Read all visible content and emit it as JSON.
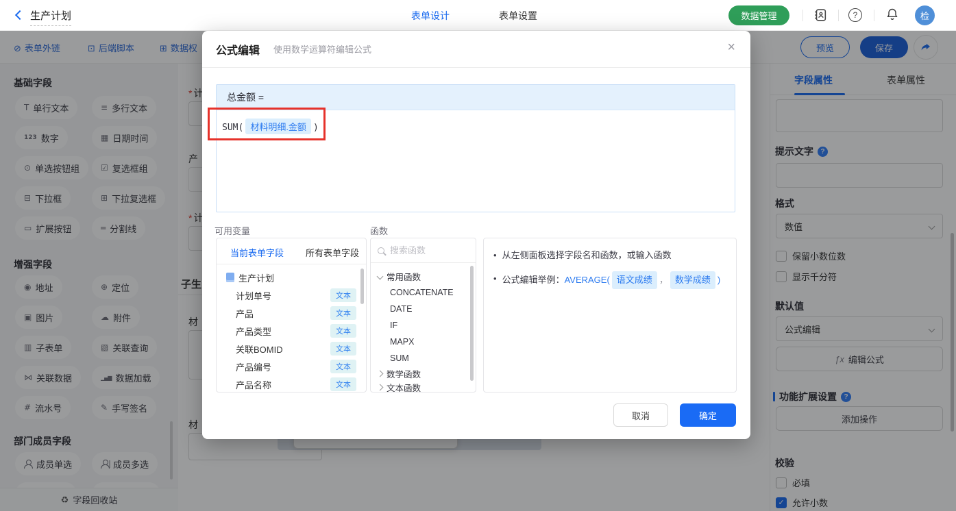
{
  "topbar": {
    "title": "生产计划",
    "nav_tabs": [
      {
        "label": "表单设计",
        "active": true
      },
      {
        "label": "表单设置",
        "active": false
      }
    ],
    "data_manage_label": "数据管理",
    "avatar_text": "检"
  },
  "toolbar": {
    "links": [
      {
        "label": "表单外链",
        "glyph": "⊘"
      },
      {
        "label": "后端脚本",
        "glyph": "⊡"
      },
      {
        "label": "数据权",
        "glyph": "⊞"
      }
    ],
    "preview_label": "预览",
    "save_label": "保存"
  },
  "sidebar": {
    "sections": [
      {
        "title": "基础字段",
        "items": [
          {
            "label": "单行文本",
            "glyph": "T"
          },
          {
            "label": "多行文本",
            "glyph": "≡"
          },
          {
            "label": "数字",
            "glyph": "123"
          },
          {
            "label": "日期时间",
            "glyph": "▦"
          },
          {
            "label": "单选按钮组",
            "glyph": "⊙"
          },
          {
            "label": "复选框组",
            "glyph": "☑"
          },
          {
            "label": "下拉框",
            "glyph": "⊟"
          },
          {
            "label": "下拉复选框",
            "glyph": "⊞"
          },
          {
            "label": "扩展按钮",
            "glyph": "▭"
          },
          {
            "label": "分割线",
            "glyph": "═"
          }
        ]
      },
      {
        "title": "增强字段",
        "items": [
          {
            "label": "地址",
            "glyph": "◉"
          },
          {
            "label": "定位",
            "glyph": "⊕"
          },
          {
            "label": "图片",
            "glyph": "▣"
          },
          {
            "label": "附件",
            "glyph": "☁"
          },
          {
            "label": "子表单",
            "glyph": "▥"
          },
          {
            "label": "关联查询",
            "glyph": "▧"
          },
          {
            "label": "关联数据",
            "glyph": "⋈"
          },
          {
            "label": "数据加载",
            "glyph": "▁▄▆"
          },
          {
            "label": "流水号",
            "glyph": "#"
          },
          {
            "label": "手写签名",
            "glyph": "✎"
          }
        ]
      },
      {
        "title": "部门成员字段",
        "items": [
          {
            "label": "成员单选",
            "glyph": ""
          },
          {
            "label": "成员多选",
            "glyph": ""
          }
        ]
      }
    ],
    "recycle_label": "字段回收站",
    "recycle_glyph": "♻"
  },
  "canvas": {
    "fields": [
      {
        "label_fragment": "计",
        "required": "*"
      },
      {
        "label_fragment": "产",
        "required": ""
      },
      {
        "label_fragment": "计",
        "required": "*"
      },
      {
        "label_fragment": "子生",
        "required": ""
      },
      {
        "label_fragment": "材",
        "required": ""
      },
      {
        "label_fragment": "材",
        "required": ""
      }
    ]
  },
  "modal": {
    "title": "公式编辑",
    "subtitle": "使用数学运算符编辑公式",
    "close_glyph": "×",
    "formula_target": "总金额 =",
    "formula_prefix": "SUM(",
    "formula_chip": "材料明细.金额",
    "formula_suffix": ")",
    "variables": {
      "title": "可用变量",
      "tabs": [
        {
          "label": "当前表单字段",
          "active": true
        },
        {
          "label": "所有表单字段",
          "active": false
        }
      ],
      "root": "生产计划",
      "fields": [
        {
          "name": "计划单号",
          "type": "文本"
        },
        {
          "name": "产品",
          "type": "文本"
        },
        {
          "name": "产品类型",
          "type": "文本"
        },
        {
          "name": "关联BOMID",
          "type": "文本"
        },
        {
          "name": "产品编号",
          "type": "文本"
        },
        {
          "name": "产品名称",
          "type": "文本"
        }
      ]
    },
    "functions": {
      "title": "函数",
      "search_placeholder": "搜索函数",
      "groups": [
        {
          "name": "常用函数",
          "expanded": true,
          "items": [
            "CONCATENATE",
            "DATE",
            "IF",
            "MAPX",
            "SUM"
          ]
        },
        {
          "name": "数学函数",
          "expanded": false,
          "items": []
        },
        {
          "name": "文本函数",
          "expanded": false,
          "items": []
        }
      ]
    },
    "tips": {
      "line1": "从左侧面板选择字段名和函数，或输入函数",
      "line2_prefix": "公式编辑举例：",
      "line2_func": "AVERAGE(",
      "line2_chip1": "语文成绩",
      "line2_comma": "，",
      "line2_chip2": "数学成绩",
      "line2_suffix": ")"
    },
    "cancel_label": "取消",
    "confirm_label": "确定"
  },
  "panel": {
    "tabs": [
      {
        "label": "字段属性",
        "active": true
      },
      {
        "label": "表单属性",
        "active": false
      }
    ],
    "hint_label": "提示文字",
    "format_label": "格式",
    "format_value": "数值",
    "keep_decimal_label": "保留小数位数",
    "thousand_label": "显示千分符",
    "default_label": "默认值",
    "default_value": "公式编辑",
    "fx_prefix": "ƒx",
    "edit_formula_label": "编辑公式",
    "ext_title": "功能扩展设置",
    "add_action_label": "添加操作",
    "validation_title": "校验",
    "required_label": "必填",
    "allow_decimal_label": "允许小数"
  },
  "colors": {
    "accent": "#1b6bf0",
    "green": "#2f9e59",
    "highlight_red": "#e6322b",
    "chip_bg": "#dbeefd",
    "badge_bg": "#dff2f4"
  }
}
